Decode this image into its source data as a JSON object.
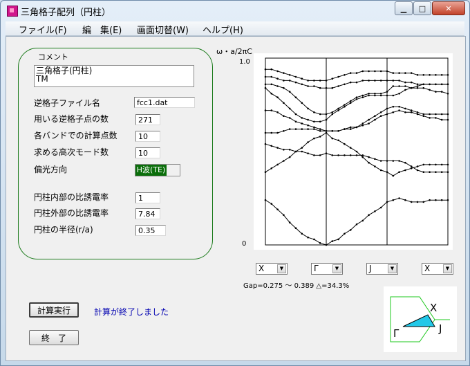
{
  "window": {
    "title": "三角格子配列（円柱）"
  },
  "menu": [
    "ファイル(F)",
    "編　集(E)",
    "画面切替(W)",
    "ヘルプ(H)"
  ],
  "comment": {
    "label": "コメント",
    "lines": [
      "三角格子(円柱)",
      "TM"
    ]
  },
  "params": [
    {
      "label": "逆格子ファイル名",
      "value": "fcc1.dat"
    },
    {
      "label": "用いる逆格子点の数",
      "value": "271"
    },
    {
      "label": "各バンドでの計算点数",
      "value": "10"
    },
    {
      "label": "求める高次モード数",
      "value": "10"
    }
  ],
  "polarization": {
    "label": "偏光方向",
    "value": "H波(TE)"
  },
  "cylinder": [
    {
      "label": "円柱内部の比誘電率",
      "value": "1"
    },
    {
      "label": "円柱外部の比誘電率",
      "value": "7.84"
    },
    {
      "label": "円柱の半径(r/a)",
      "value": "0.35"
    }
  ],
  "buttons": {
    "run": "計算実行",
    "end": "終　了"
  },
  "status": "計算が終了しました",
  "plot": {
    "ylabel": "ω・a/2πC",
    "ymax_label": "1.0",
    "ymin_label": "0"
  },
  "path_selectors": [
    "X",
    "Γ",
    "J",
    "X"
  ],
  "gap_text": "Gap=0.275 〜 0.389 △=34.3%",
  "bz": {
    "labels": [
      "X",
      "Γ",
      "J"
    ]
  },
  "colors": {
    "accent_green": "#0a6e0a",
    "status_blue": "#0000b0",
    "bz_fill": "#22c8e8"
  },
  "chart_data": {
    "type": "line",
    "ylim": [
      0,
      1
    ],
    "segments": [
      "X-Γ",
      "Γ-J",
      "J-X"
    ],
    "x": [
      0,
      0.1,
      0.2,
      0.3,
      0.4,
      0.5,
      0.6,
      0.7,
      0.8,
      0.9,
      1.0,
      1.1,
      1.2,
      1.3,
      1.4,
      1.5,
      1.6,
      1.7,
      1.8,
      1.9,
      2.0,
      2.1,
      2.2,
      2.3,
      2.4,
      2.5,
      2.6,
      2.7,
      2.8,
      2.9,
      3.0
    ],
    "series": [
      {
        "values": [
          0.24,
          0.22,
          0.19,
          0.16,
          0.12,
          0.09,
          0.06,
          0.04,
          0.03,
          0.01,
          0.0,
          0.02,
          0.03,
          0.06,
          0.08,
          0.11,
          0.13,
          0.16,
          0.18,
          0.2,
          0.23,
          0.24,
          0.25,
          0.24,
          0.23,
          0.23,
          0.23,
          0.24,
          0.24,
          0.24,
          0.24
        ]
      },
      {
        "values": [
          0.39,
          0.41,
          0.43,
          0.45,
          0.47,
          0.5,
          0.52,
          0.55,
          0.57,
          0.58,
          0.6,
          0.57,
          0.56,
          0.54,
          0.52,
          0.5,
          0.47,
          0.44,
          0.42,
          0.4,
          0.39,
          0.37,
          0.39,
          0.4,
          0.41,
          0.42,
          0.43,
          0.43,
          0.43,
          0.43,
          0.43
        ]
      },
      {
        "values": [
          0.54,
          0.53,
          0.52,
          0.51,
          0.51,
          0.5,
          0.5,
          0.49,
          0.48,
          0.48,
          0.49,
          0.48,
          0.48,
          0.48,
          0.48,
          0.48,
          0.48,
          0.47,
          0.46,
          0.45,
          0.45,
          0.45,
          0.45,
          0.44,
          0.42,
          0.4,
          0.39,
          0.39,
          0.39,
          0.39,
          0.39
        ]
      },
      {
        "values": [
          0.6,
          0.6,
          0.6,
          0.61,
          0.62,
          0.62,
          0.62,
          0.62,
          0.62,
          0.61,
          0.61,
          0.61,
          0.61,
          0.62,
          0.62,
          0.63,
          0.65,
          0.67,
          0.69,
          0.71,
          0.73,
          0.74,
          0.74,
          0.73,
          0.72,
          0.71,
          0.7,
          0.7,
          0.7,
          0.7,
          0.7
        ]
      },
      {
        "values": [
          0.72,
          0.72,
          0.71,
          0.69,
          0.68,
          0.66,
          0.65,
          0.64,
          0.63,
          0.62,
          0.61,
          0.61,
          0.61,
          0.62,
          0.63,
          0.63,
          0.64,
          0.65,
          0.67,
          0.69,
          0.7,
          0.71,
          0.72,
          0.71,
          0.71,
          0.7,
          0.69,
          0.68,
          0.68,
          0.67,
          0.67
        ]
      },
      {
        "values": [
          0.84,
          0.81,
          0.79,
          0.76,
          0.73,
          0.7,
          0.68,
          0.67,
          0.66,
          0.66,
          0.67,
          0.7,
          0.72,
          0.74,
          0.76,
          0.78,
          0.79,
          0.8,
          0.8,
          0.8,
          0.8,
          0.8,
          0.81,
          0.83,
          0.84,
          0.85,
          0.86,
          0.86,
          0.86,
          0.86,
          0.86
        ]
      },
      {
        "values": [
          0.86,
          0.86,
          0.85,
          0.84,
          0.82,
          0.79,
          0.76,
          0.73,
          0.71,
          0.7,
          0.7,
          0.71,
          0.73,
          0.75,
          0.77,
          0.79,
          0.8,
          0.81,
          0.81,
          0.81,
          0.82,
          0.85,
          0.85,
          0.85,
          0.84,
          0.84,
          0.84,
          0.83,
          0.82,
          0.82,
          0.81
        ]
      },
      {
        "values": [
          0.9,
          0.9,
          0.89,
          0.88,
          0.88,
          0.87,
          0.86,
          0.85,
          0.85,
          0.84,
          0.84,
          0.84,
          0.85,
          0.86,
          0.87,
          0.87,
          0.88,
          0.88,
          0.88,
          0.88,
          0.88,
          0.88,
          0.88,
          0.87,
          0.87,
          0.86,
          0.86,
          0.86,
          0.86,
          0.86,
          0.86
        ]
      },
      {
        "values": [
          0.94,
          0.94,
          0.93,
          0.92,
          0.91,
          0.9,
          0.89,
          0.88,
          0.88,
          0.88,
          0.88,
          0.89,
          0.9,
          0.91,
          0.92,
          0.92,
          0.93,
          0.93,
          0.93,
          0.93,
          0.93,
          0.92,
          0.92,
          0.92,
          0.92,
          0.91,
          0.91,
          0.91,
          0.91,
          0.91,
          0.91
        ]
      }
    ]
  }
}
